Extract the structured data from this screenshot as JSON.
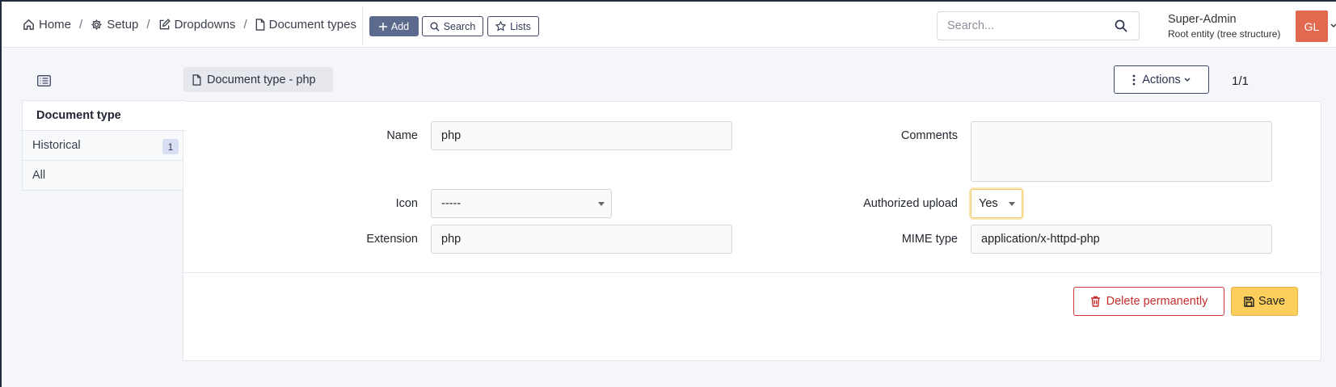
{
  "breadcrumb": {
    "items": [
      {
        "label": "Home",
        "icon": "home-icon"
      },
      {
        "label": "Setup",
        "icon": "gear-icon"
      },
      {
        "label": "Dropdowns",
        "icon": "edit-icon"
      },
      {
        "label": "Document types",
        "icon": "file-icon"
      }
    ],
    "separator": "/"
  },
  "toolbar": {
    "add_label": "Add",
    "search_label": "Search",
    "lists_label": "Lists"
  },
  "global_search": {
    "placeholder": "Search..."
  },
  "user": {
    "name": "Super-Admin",
    "entity": "Root entity (tree structure)",
    "initials": "GL",
    "avatar_color": "#e0694f"
  },
  "tabs": [
    {
      "label": "Document type",
      "active": true
    },
    {
      "label": "Historical",
      "count": "1"
    },
    {
      "label": "All"
    }
  ],
  "item": {
    "title": "Document type - php",
    "actions_label": "Actions",
    "pager": "1/1"
  },
  "form": {
    "name": {
      "label": "Name",
      "value": "php"
    },
    "comments": {
      "label": "Comments",
      "value": ""
    },
    "icon": {
      "label": "Icon",
      "value": "-----"
    },
    "authorized_upload": {
      "label": "Authorized upload",
      "value": "Yes"
    },
    "extension": {
      "label": "Extension",
      "value": "php"
    },
    "mime_type": {
      "label": "MIME type",
      "value": "application/x-httpd-php"
    }
  },
  "buttons": {
    "delete_label": "Delete permanently",
    "save_label": "Save"
  },
  "colors": {
    "primary": "#5c6a8e",
    "danger": "#cf3a3a",
    "save": "#fccf5c"
  }
}
